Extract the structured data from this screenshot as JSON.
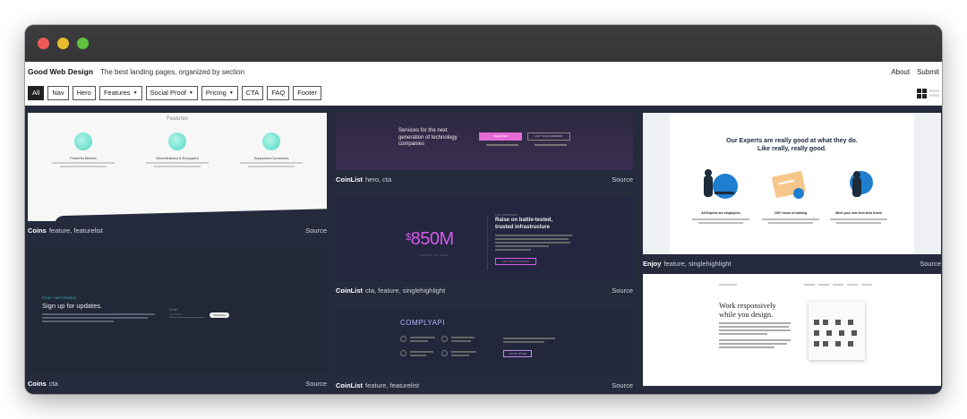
{
  "header": {
    "brand": "Good Web Design",
    "tagline": "The best landing pages, organized by section",
    "links": [
      "About",
      "Submit"
    ]
  },
  "filters": [
    {
      "label": "All",
      "active": true,
      "dropdown": false
    },
    {
      "label": "Nav",
      "active": false,
      "dropdown": false
    },
    {
      "label": "Hero",
      "active": false,
      "dropdown": false
    },
    {
      "label": "Features",
      "active": false,
      "dropdown": true
    },
    {
      "label": "Social Proof",
      "active": false,
      "dropdown": true
    },
    {
      "label": "Pricing",
      "active": false,
      "dropdown": true
    },
    {
      "label": "CTA",
      "active": false,
      "dropdown": false
    },
    {
      "label": "FAQ",
      "active": false,
      "dropdown": false
    },
    {
      "label": "Footer",
      "active": false,
      "dropdown": false
    }
  ],
  "cards": {
    "coins_feature": {
      "name": "Coins",
      "tags": "feature, featurelist",
      "source": "Source",
      "preview": {
        "title": "Features",
        "items": [
          "Powerful Metrics",
          "Decentralized & Encrypted",
          "Supported Currencies"
        ]
      }
    },
    "coins_cta": {
      "name": "Coins",
      "tags": "cta",
      "source": "Source",
      "preview": {
        "eyebrow": "STAY INFORMED",
        "heading": "Sign up for updates.",
        "input_label": "Email",
        "input_placeholder": "Your Email",
        "button": "Subscribe"
      }
    },
    "coinlist_hero": {
      "name": "CoinList",
      "tags": "hero, cta",
      "source": "Source",
      "preview": {
        "heading": "Services for the next generation of technology companies",
        "primary": "REGISTER",
        "secondary": "LIST YOUR COMPANY"
      }
    },
    "coinlist_850": {
      "name": "CoinList",
      "tags": "cta, feature, singlehighlight",
      "source": "Source",
      "preview": {
        "currency": "$",
        "figure": "850M",
        "sub": "RAISED TO DATE",
        "eyebrow": "FOR COMPANIES",
        "heading": "Raise on battle-tested, trusted infrastructure",
        "button": "LIST YOUR COMPANY"
      }
    },
    "coinlist_comply": {
      "name": "CoinList",
      "tags": "feature, featurelist",
      "source": "Source",
      "preview": {
        "logo": "COMPLYAPI",
        "button": "LEARN MORE"
      }
    },
    "enjoy": {
      "name": "Enjoy",
      "tags": "feature, singlehighlight",
      "source": "Source",
      "preview": {
        "heading_1": "Our Experts are really good at what they do.",
        "heading_2": "Like really, really good.",
        "items": [
          "All Experts are employees",
          "140+ hours of training",
          "Meet your new tech best friend"
        ]
      }
    },
    "work": {
      "preview": {
        "heading_1": "Work responsively",
        "heading_2": "while you design."
      }
    }
  }
}
